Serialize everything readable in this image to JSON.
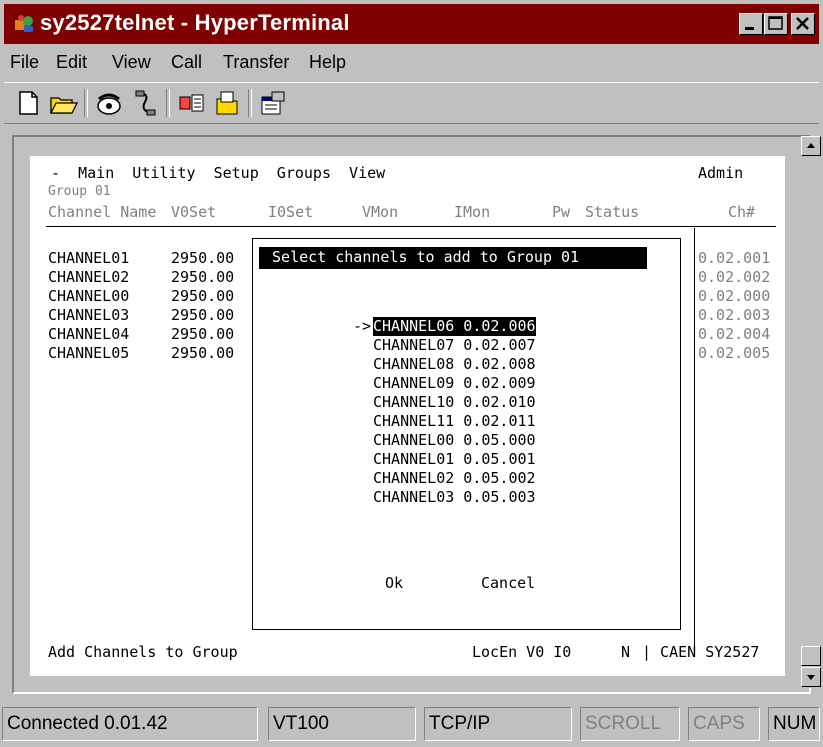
{
  "window": {
    "title": "sy2527telnet - HyperTerminal"
  },
  "menu": [
    "File",
    "Edit",
    "View",
    "Call",
    "Transfer",
    "Help"
  ],
  "toolbar": {
    "icons": [
      "new-document-icon",
      "open-folder-icon",
      "connect-phone-icon",
      "disconnect-icon",
      "send-icon",
      "receive-icon",
      "properties-icon"
    ]
  },
  "terminal": {
    "menu_line": " -  Main  Utility  Setup  Groups  View",
    "role": "Admin",
    "group_label": "Group 01",
    "headers": {
      "name": "Channel Name",
      "v0set": "V0Set",
      "i0set": "I0Set",
      "vmon": "VMon",
      "imon": "IMon",
      "pw": "Pw",
      "status": "Status",
      "ch": "Ch#"
    },
    "rows": [
      {
        "name": "CHANNEL01",
        "v0set": "2950.00",
        "ch": "0.02.001"
      },
      {
        "name": "CHANNEL02",
        "v0set": "2950.00",
        "ch": "0.02.002"
      },
      {
        "name": "CHANNEL00",
        "v0set": "2950.00",
        "ch": "0.02.000"
      },
      {
        "name": "CHANNEL03",
        "v0set": "2950.00",
        "ch": "0.02.003"
      },
      {
        "name": "CHANNEL04",
        "v0set": "2950.00",
        "ch": "0.02.004"
      },
      {
        "name": "CHANNEL05",
        "v0set": "2950.00",
        "ch": "0.02.005"
      }
    ],
    "bottom_left": "Add Channels to Group",
    "bottom_mid": "LocEn V0 I0",
    "bottom_n": "N",
    "bottom_right": "| CAEN SY2527"
  },
  "dialog": {
    "title": " Select channels to add to Group 01",
    "cursor": "->",
    "items": [
      "CHANNEL06 0.02.006",
      "CHANNEL07 0.02.007",
      "CHANNEL08 0.02.008",
      "CHANNEL09 0.02.009",
      "CHANNEL10 0.02.010",
      "CHANNEL11 0.02.011",
      "CHANNEL00 0.05.000",
      "CHANNEL01 0.05.001",
      "CHANNEL02 0.05.002",
      "CHANNEL03 0.05.003"
    ],
    "ok": "Ok",
    "cancel": "Cancel"
  },
  "statusbar": {
    "connected": "Connected 0.01.42",
    "emulation": "VT100",
    "protocol": "TCP/IP",
    "scroll": "SCROLL",
    "caps": "CAPS",
    "num": "NUM"
  },
  "colors": {
    "title_bar": "#800000",
    "chrome": "#c0c0c0"
  }
}
